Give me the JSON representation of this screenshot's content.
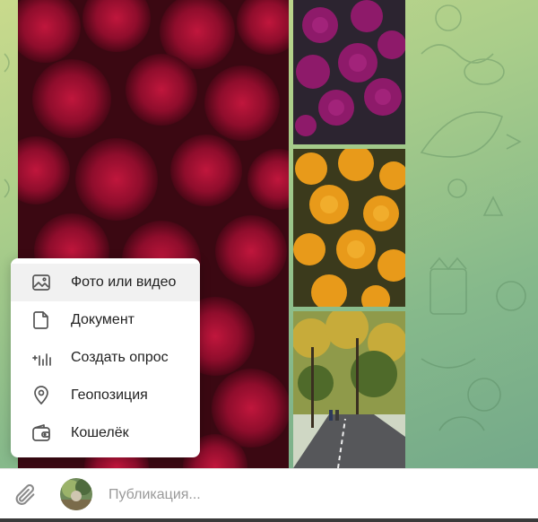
{
  "attach_menu": {
    "items": [
      {
        "icon": "image-icon",
        "label": "Фото или видео",
        "highlighted": true
      },
      {
        "icon": "document-icon",
        "label": "Документ",
        "highlighted": false
      },
      {
        "icon": "poll-icon",
        "label": "Создать опрос",
        "highlighted": false
      },
      {
        "icon": "location-icon",
        "label": "Геопозиция",
        "highlighted": false
      },
      {
        "icon": "wallet-icon",
        "label": "Кошелёк",
        "highlighted": false
      }
    ]
  },
  "composer": {
    "placeholder": "Публикация..."
  },
  "album": {
    "photos": [
      {
        "subject": "red chrysanthemums"
      },
      {
        "subject": "purple chrysanthemums"
      },
      {
        "subject": "orange chrysanthemums"
      },
      {
        "subject": "autumn park path"
      }
    ]
  },
  "colors": {
    "accent": "#3390ec",
    "menu_bg": "#ffffff",
    "menu_highlight": "#f1f1f1"
  }
}
